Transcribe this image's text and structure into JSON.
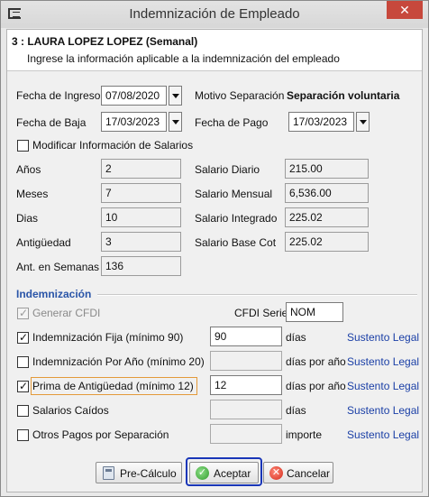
{
  "window": {
    "title": "Indemnización de Empleado",
    "close_glyph": "✕"
  },
  "header": {
    "employee": "3 : LAURA LOPEZ LOPEZ (Semanal)",
    "instruction": "Ingrese la información aplicable a la indemnización del empleado"
  },
  "dates": {
    "fecha_ingreso_label": "Fecha de Ingreso",
    "fecha_ingreso": "07/08/2020",
    "fecha_baja_label": "Fecha de Baja",
    "fecha_baja": "17/03/2023",
    "motivo_label": "Motivo Separación",
    "motivo": "Separación voluntaria",
    "fecha_pago_label": "Fecha de Pago",
    "fecha_pago": "17/03/2023"
  },
  "modificar_salarios": {
    "label": "Modificar Información de Salarios",
    "checked": false
  },
  "antiguedad": {
    "anios_label": "Años",
    "anios": "2",
    "meses_label": "Meses",
    "meses": "7",
    "dias_label": "Dias",
    "dias": "10",
    "antiguedad_label": "Antigüedad",
    "antiguedad": "3",
    "semanas_label": "Ant. en Semanas",
    "semanas": "136"
  },
  "salarios": {
    "diario_label": "Salario Diario",
    "diario": "215.00",
    "mensual_label": "Salario Mensual",
    "mensual": "6,536.00",
    "integrado_label": "Salario Integrado",
    "integrado": "225.02",
    "base_label": "Salario Base Cot",
    "base": "225.02"
  },
  "indemnizacion": {
    "section_title": "Indemnización",
    "generar_cfdi_label": "Generar CFDI",
    "cfdi_serie_label": "CFDI Serie",
    "cfdi_serie": "NOM",
    "rows": [
      {
        "label": "Indemnización Fija (mínimo 90)",
        "checked": true,
        "value": "90",
        "unit": "días",
        "link": "Sustento Legal"
      },
      {
        "label": "Indemnización Por Año (mínimo 20)",
        "checked": false,
        "value": "",
        "unit": "días por año",
        "link": "Sustento Legal"
      },
      {
        "label": "Prima de Antigüedad (mínimo 12)",
        "checked": true,
        "value": "12",
        "unit": "días por año",
        "link": "Sustento Legal"
      },
      {
        "label": "Salarios Caídos",
        "checked": false,
        "value": "",
        "unit": "días",
        "link": "Sustento Legal"
      },
      {
        "label": "Otros Pagos por Separación",
        "checked": false,
        "value": "",
        "unit": "importe",
        "link": "Sustento Legal"
      }
    ]
  },
  "buttons": {
    "precalculo": "Pre-Cálculo",
    "aceptar": "Aceptar",
    "cancelar": "Cancelar"
  },
  "icons": {
    "check": "✓",
    "ok": "✓",
    "cancel": "✕"
  }
}
